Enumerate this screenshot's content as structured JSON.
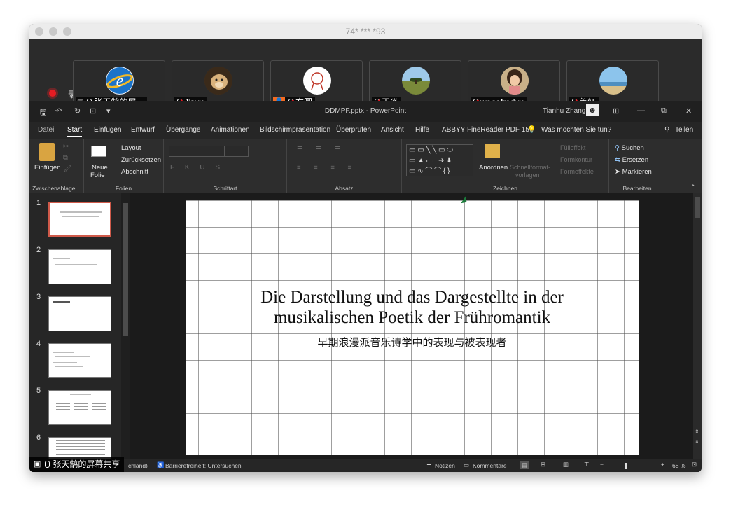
{
  "window": {
    "title": "74* *** *93"
  },
  "meeting": {
    "recording_label": "录制中",
    "participants": [
      {
        "name": "张天鹄的屏…"
      },
      {
        "name": "Jiayu"
      },
      {
        "name": "方圆"
      },
      {
        "name": "王炎"
      },
      {
        "name": "wenefredyu"
      },
      {
        "name": "姜红"
      }
    ],
    "share_label": "张天鹄的屏幕共享"
  },
  "powerpoint": {
    "file_title": "DDMPF.pptx  -  PowerPoint",
    "user": "Tianhu Zhang",
    "tabs": [
      "Datei",
      "Start",
      "Einfügen",
      "Entwurf",
      "Übergänge",
      "Animationen",
      "Bildschirmpräsentation",
      "Überprüfen",
      "Ansicht",
      "Hilfe",
      "ABBYY FineReader PDF 15"
    ],
    "tell_me": "Was möchten Sie tun?",
    "share_btn": "Teilen",
    "ribbon": {
      "paste": "Einfügen",
      "new_slide_1": "Neue",
      "new_slide_2": "Folie",
      "layout": "Layout",
      "reset": "Zurücksetzen",
      "section": "Abschnitt",
      "arrange": "Anordnen",
      "quick_styles_1": "Schnellformat-",
      "quick_styles_2": "vorlagen",
      "shape_fill": "Fülleffekt",
      "shape_outline": "Formkontur",
      "shape_effects": "Formeffekte",
      "find": "Suchen",
      "replace": "Ersetzen",
      "select": "Markieren",
      "groups": [
        "Zwischenablage",
        "Folien",
        "Schriftart",
        "Absatz",
        "Zeichnen",
        "Bearbeiten"
      ]
    },
    "slide_numbers": [
      "1",
      "2",
      "3",
      "4",
      "5",
      "6"
    ],
    "slide": {
      "title_line1": "Die Darstellung und das Dargestellte in der",
      "title_line2": "musikalischen Poetik der Frühromantik",
      "subtitle": "早期浪漫派音乐诗学中的表现与被表现者"
    },
    "status": {
      "language": "chland)",
      "accessibility": "Barrierefreiheit: Untersuchen",
      "notes": "Notizen",
      "comments": "Kommentare",
      "zoom": "68 %"
    }
  }
}
